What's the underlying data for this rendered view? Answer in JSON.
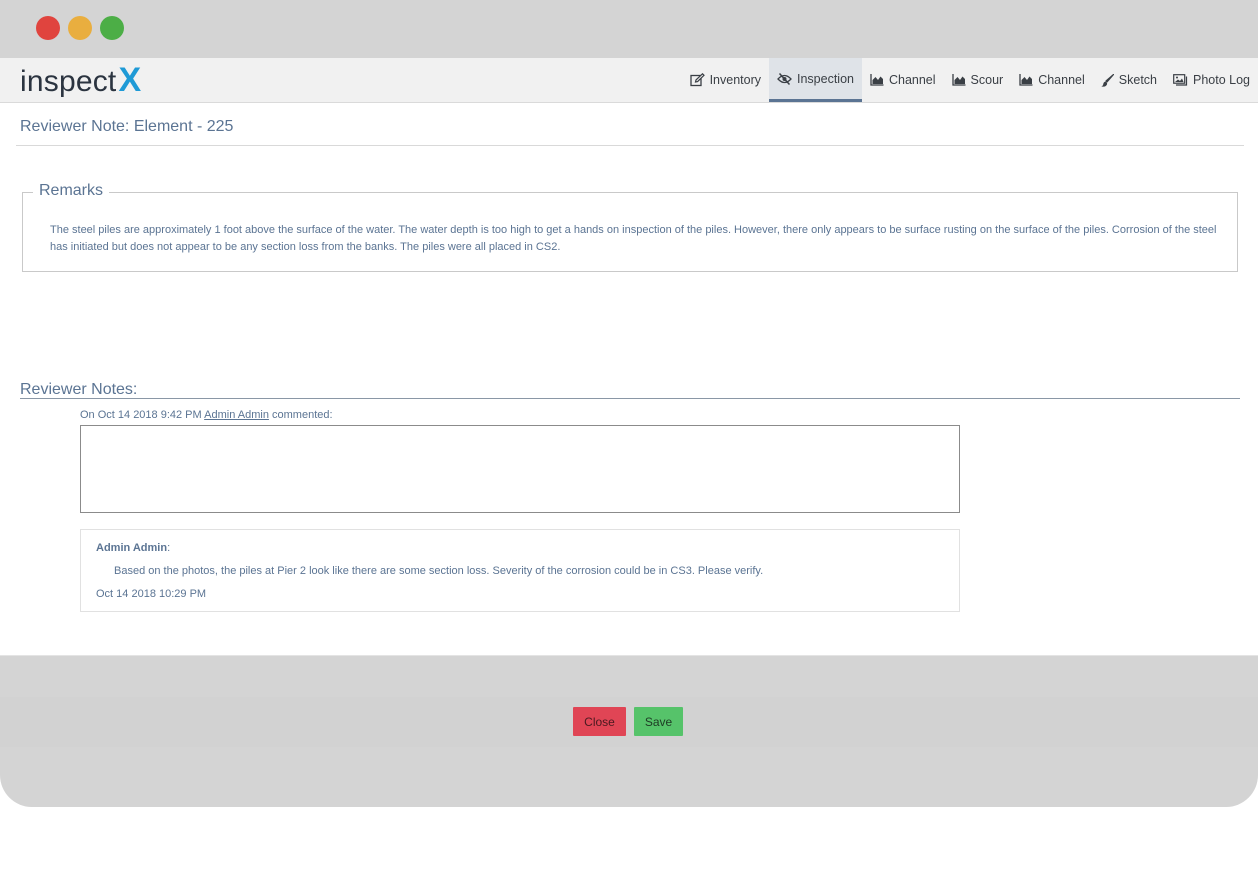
{
  "app": {
    "logo_text": "inspect",
    "logo_mark": "X"
  },
  "nav": {
    "tabs": [
      {
        "label": "Inventory",
        "icon": "edit-icon",
        "active": false
      },
      {
        "label": "Inspection",
        "icon": "eye-slash-icon",
        "active": true
      },
      {
        "label": "Channel",
        "icon": "area-chart-icon",
        "active": false
      },
      {
        "label": "Scour",
        "icon": "area-chart-icon",
        "active": false
      },
      {
        "label": "Channel",
        "icon": "area-chart-icon",
        "active": false
      },
      {
        "label": "Sketch",
        "icon": "paintbrush-icon",
        "active": false
      },
      {
        "label": "Photo Log",
        "icon": "photo-album-icon",
        "active": false
      }
    ]
  },
  "page": {
    "title": "Reviewer Note: Element - 225"
  },
  "remarks": {
    "legend": "Remarks",
    "text": "The steel piles are approximately 1 foot above the surface of the water. The water depth is too high to get a hands on inspection of the piles. However, there only appears to be surface rusting on the surface of the piles. Corrosion of the steel has initiated but  does not appear to be any section loss from the banks. The piles were all placed in CS2."
  },
  "reviewer_notes": {
    "heading": "Reviewer Notes:",
    "new_comment": {
      "prefix": "On Oct 14 2018 9:42 PM",
      "author": "Admin Admin",
      "suffix": "commented:",
      "value": ""
    },
    "notes": [
      {
        "author": "Admin Admin",
        "text": "Based on the photos, the piles at Pier 2 look like there are some section loss. Severity of the corrosion could be in CS3. Please verify.",
        "timestamp": "Oct 14 2018 10:29 PM"
      }
    ]
  },
  "footer": {
    "close_label": "Close",
    "save_label": "Save"
  },
  "colors": {
    "accent": "#5b7493",
    "logo_x": "#1f9ad6",
    "close_button": "#e04555",
    "save_button": "#56c36a"
  }
}
